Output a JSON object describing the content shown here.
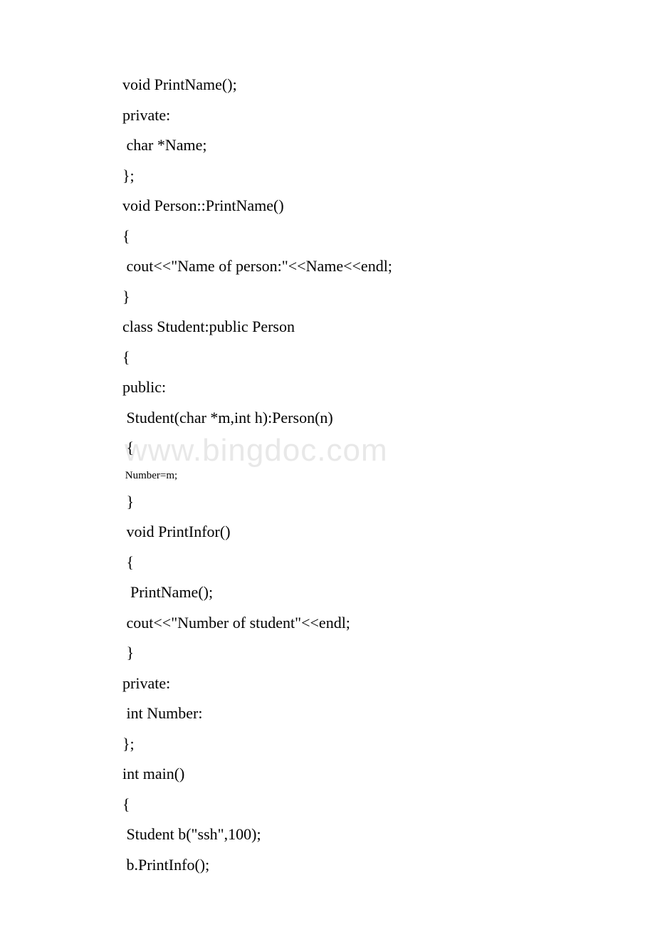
{
  "watermark": "www.bingdoc.com",
  "lines": [
    "void PrintName();",
    "private:",
    " char *Name;",
    "};",
    "void Person::PrintName()",
    "{",
    " cout<<\"Name of person:\"<<Name<<endl;",
    "}",
    "class Student:public Person",
    "{",
    "public:",
    " Student(char *m,int h):Person(n)",
    " {",
    " Number=m;",
    " }",
    " void PrintInfor()",
    " {",
    "  PrintName();",
    " cout<<\"Number of student\"<<endl;",
    " }",
    "private:",
    " int Number:",
    "};",
    "int main()",
    "{",
    " Student b(\"ssh\",100);",
    " b.PrintInfo();"
  ]
}
